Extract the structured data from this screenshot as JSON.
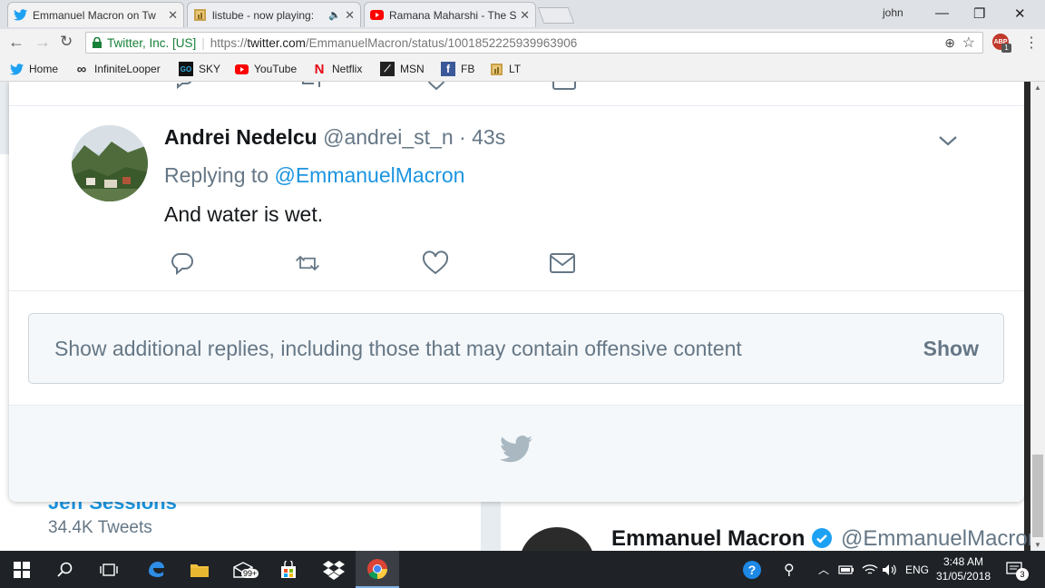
{
  "browser": {
    "tabs": [
      {
        "title": "Emmanuel Macron on Tw",
        "icon": "twitter-bird-icon",
        "active": true
      },
      {
        "title": "listube - now playing:",
        "icon": "listube-icon",
        "active": false
      },
      {
        "title": "Ramana Maharshi - The S",
        "icon": "youtube-icon",
        "active": false
      }
    ],
    "user_name": "john",
    "site_identity": "Twitter, Inc. [US]",
    "url_prefix": "https://",
    "url_host": "twitter.com",
    "url_path": "/EmmanuelMacron/status/1001852225939963906",
    "extension_badge": "ABP",
    "extension_count": "1",
    "bookmarks": [
      {
        "label": "Home",
        "icon": "twitter-bird-icon"
      },
      {
        "label": "InfiniteLooper",
        "icon": "infinity-icon"
      },
      {
        "label": "SKY",
        "icon": "go-icon"
      },
      {
        "label": "YouTube",
        "icon": "youtube-icon"
      },
      {
        "label": "Netflix",
        "icon": "netflix-icon"
      },
      {
        "label": "MSN",
        "icon": "msn-icon"
      },
      {
        "label": "FB",
        "icon": "facebook-icon"
      },
      {
        "label": "LT",
        "icon": "lt-icon"
      }
    ]
  },
  "tweet": {
    "author_name": "Andrei Nedelcu",
    "author_handle": "@andrei_st_n",
    "separator": " · ",
    "time_ago": "43s",
    "replying_prefix": "Replying to ",
    "replying_to": "@EmmanuelMacron",
    "text": "And water is wet."
  },
  "more_replies": {
    "text": "Show additional replies, including those that may contain offensive content",
    "button": "Show"
  },
  "background": {
    "left_name": "Jeff Sessions",
    "left_tweets": "34.4K Tweets",
    "right_name": "Emmanuel Macron",
    "right_handle": "@EmmanuelMacron"
  },
  "taskbar": {
    "mail_badge": "99+",
    "language": "ENG",
    "time": "3:48 AM",
    "date": "31/05/2018",
    "notifications": "3"
  },
  "colors": {
    "twitter_blue": "#1da1f2",
    "mention_blue": "#1b95e0",
    "muted_text": "#657786",
    "page_bg": "#e6ecf0",
    "taskbar": "#1f2328"
  }
}
